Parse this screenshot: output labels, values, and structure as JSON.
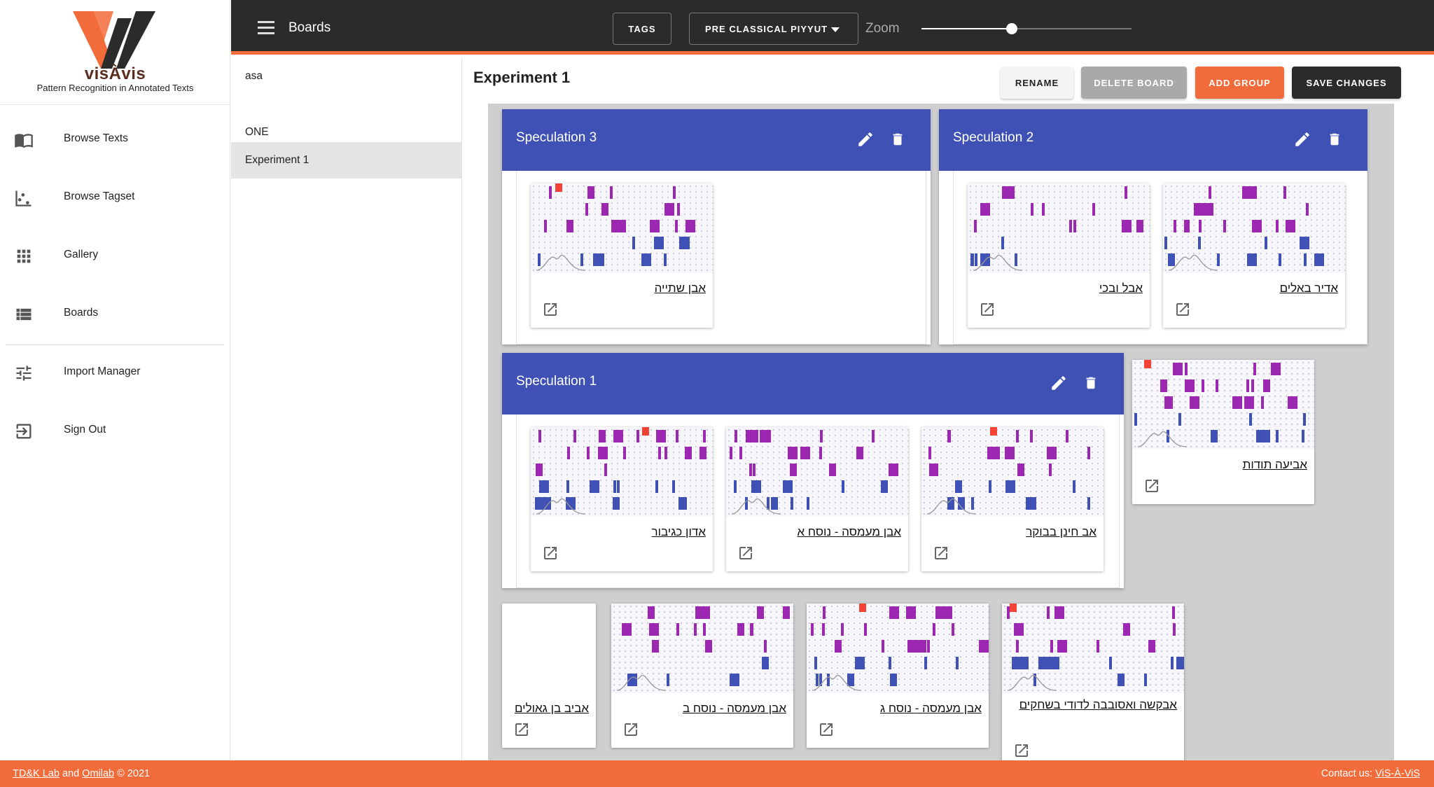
{
  "app": {
    "logo_name": "visÀvis",
    "logo_tagline": "Pattern Recognition in Annotated Texts",
    "colors": {
      "accent": "#f26b3a",
      "group_header": "#3f51b5",
      "topbar": "#2b2b2b",
      "purple_mark": "#9c27b0",
      "blue_mark": "#3f51b5",
      "red_mark": "#f44336"
    }
  },
  "sidebar": {
    "items": [
      {
        "label": "Browse Texts",
        "icon": "book-open-icon"
      },
      {
        "label": "Browse Tagset",
        "icon": "scatter-icon"
      },
      {
        "label": "Gallery",
        "icon": "grid-icon"
      },
      {
        "label": "Boards",
        "icon": "list-icon"
      },
      {
        "label": "Import Manager",
        "icon": "tune-icon"
      },
      {
        "label": "Sign Out",
        "icon": "exit-icon"
      }
    ]
  },
  "topbar": {
    "title": "Boards",
    "tags_label": "TAGS",
    "corpus_value": "PRE CLASSICAL PIYYUT",
    "zoom_label": "Zoom",
    "zoom_level": 0.43
  },
  "boards": [
    {
      "name": "asa",
      "selected": false
    },
    {
      "name": "ONE",
      "selected": false
    },
    {
      "name": "Experiment 1",
      "selected": true
    }
  ],
  "board": {
    "title": "Experiment 1",
    "actions": {
      "rename": "RENAME",
      "delete": "DELETE BOARD",
      "add_group": "ADD GROUP",
      "save": "SAVE CHANGES"
    },
    "groups": [
      {
        "title": "Speculation 3",
        "cards": [
          "אבן שתייה"
        ]
      },
      {
        "title": "Speculation 2",
        "cards": [
          "אבל ובכי",
          "אדיר באלים"
        ]
      },
      {
        "title": "Speculation 1",
        "cards": [
          "אדון כגיבור",
          "אבן מעמסה - נוסח א",
          "אב חינן בבוקר"
        ]
      }
    ],
    "loose_cards": [
      "אביעה תודות",
      "אביב בן גאולים",
      "אבן מעמסה - נוסח ב",
      "אבן מעמסה - נוסח ג",
      "אבקשה ואסובבה לדודי בשחקים"
    ]
  },
  "footer": {
    "lab": "TD&K Lab",
    "and": "and",
    "lab2": "Omilab",
    "copyright": "© 2021",
    "contact_label": "Contact us:",
    "contact_link": "ViS-À-ViS"
  }
}
